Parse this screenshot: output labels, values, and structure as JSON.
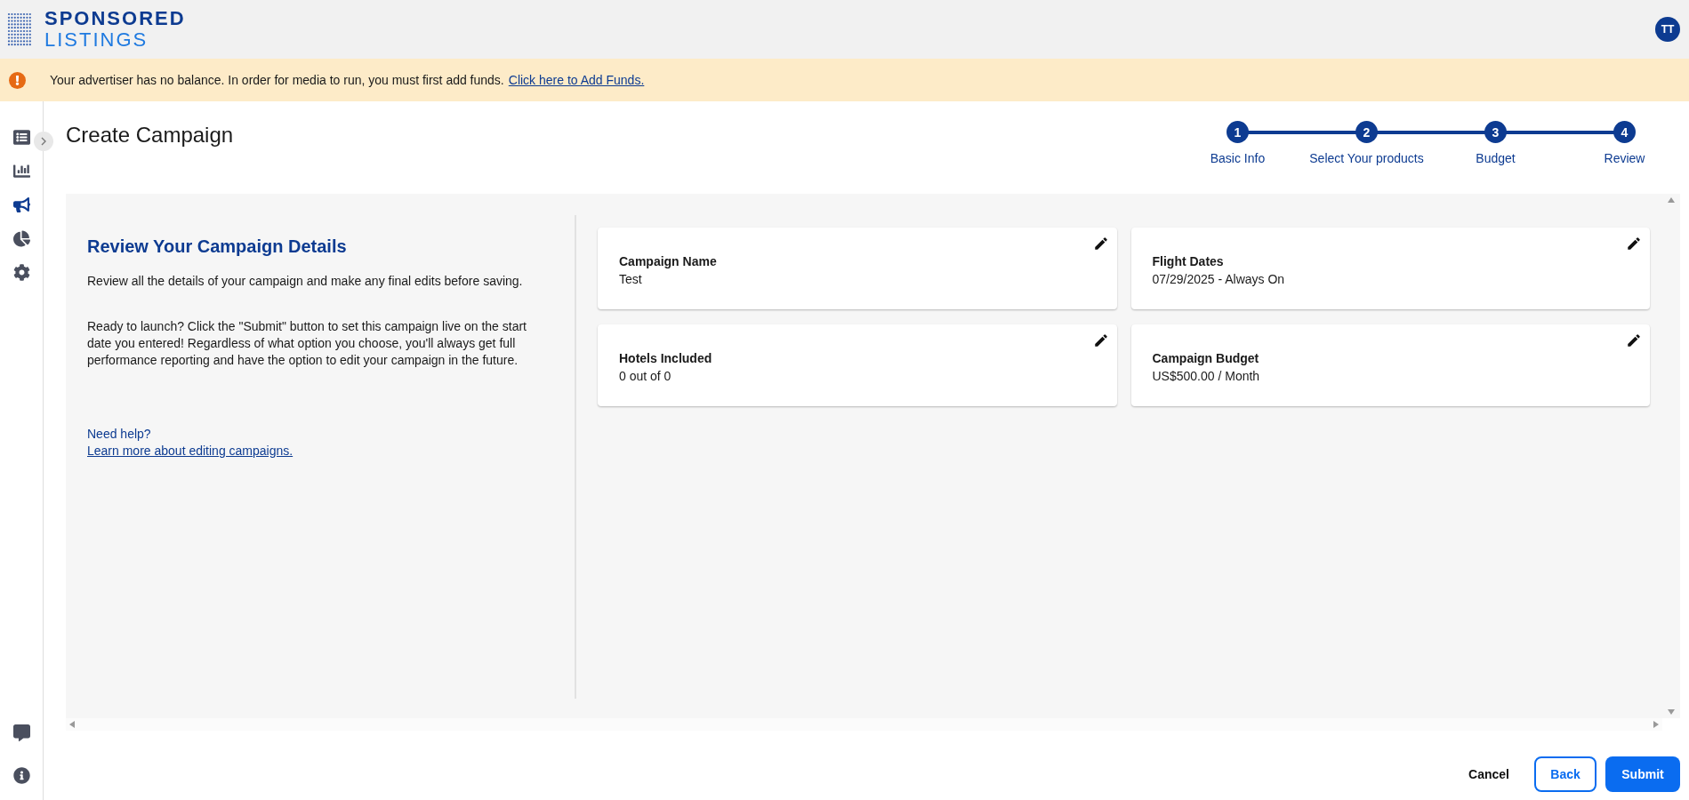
{
  "header": {
    "logo_top": "SPONSORED",
    "logo_bottom": "LISTINGS",
    "avatar": "TT"
  },
  "alert": {
    "message": "Your advertiser has no balance. In order for media to run, you must first add funds.",
    "link": "Click here to Add Funds."
  },
  "sidebar": {
    "items": [
      {
        "kind": "list",
        "selected": false
      },
      {
        "kind": "bars",
        "selected": false
      },
      {
        "kind": "megaphone",
        "selected": true
      },
      {
        "kind": "pie",
        "selected": false
      },
      {
        "kind": "gear",
        "selected": false
      }
    ],
    "bottom_items": [
      {
        "kind": "help"
      },
      {
        "kind": "info"
      }
    ]
  },
  "page_title": "Create Campaign",
  "steps": [
    {
      "number": "1",
      "label": "Basic Info"
    },
    {
      "number": "2",
      "label": "Select Your products"
    },
    {
      "number": "3",
      "label": "Budget"
    },
    {
      "number": "4",
      "label": "Review"
    }
  ],
  "intro": {
    "heading": "Review Your Campaign Details",
    "paragraphs": [
      "Review all the details of your campaign and make any final edits before saving.",
      "Ready to launch? Click the \"Submit\" button to set this campaign live on the start date you entered! Regardless of what option you choose, you'll always get full performance reporting and have the option to edit your campaign in the future."
    ],
    "help_label": "Need help?",
    "help_link": "Learn more about editing campaigns."
  },
  "cards": [
    {
      "label": "Campaign Name",
      "value": "Test"
    },
    {
      "label": "Flight Dates",
      "value": "07/29/2025 - Always On"
    },
    {
      "label": "Hotels Included",
      "value": "0 out of 0"
    },
    {
      "label": "Campaign Budget",
      "value": "US$500.00 / Month"
    }
  ],
  "buttons": {
    "cancel": "Cancel",
    "back": "Back",
    "submit": "Submit"
  }
}
